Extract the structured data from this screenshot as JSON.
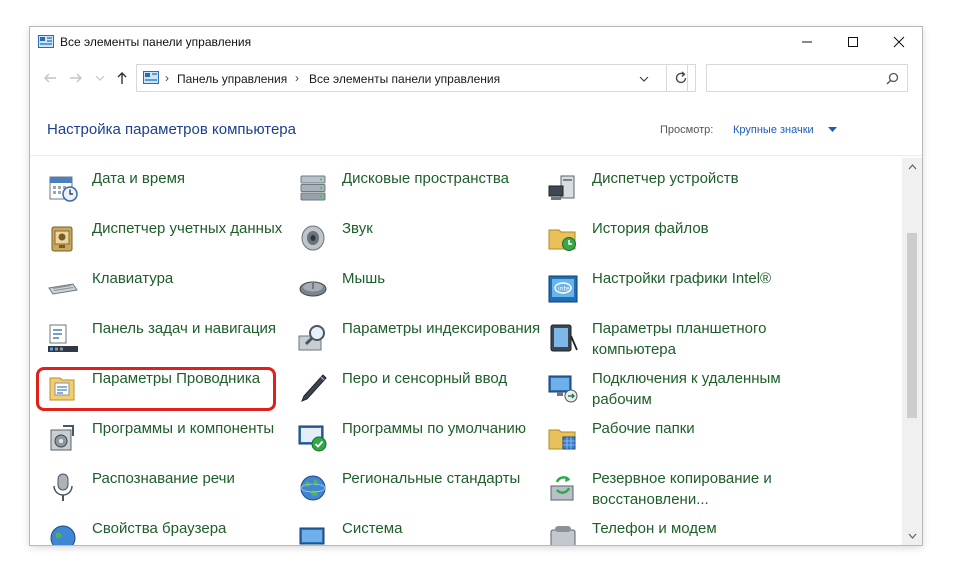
{
  "window": {
    "title": "Все элементы панели управления"
  },
  "address": {
    "crumbs": [
      "Панель управления",
      "Все элементы панели управления"
    ],
    "search_placeholder": ""
  },
  "header": {
    "title": "Настройка параметров компьютера",
    "view_label": "Просмотр:",
    "view_value": "Крупные значки"
  },
  "items": [
    [
      "Дата и время",
      "Дисковые пространства",
      "Диспетчер устройств"
    ],
    [
      "Диспетчер учетных данных",
      "Звук",
      "История файлов"
    ],
    [
      "Клавиатура",
      "Мышь",
      "Настройки графики Intel®"
    ],
    [
      "Панель задач и навигация",
      "Параметры индексирования",
      "Параметры планшетного компьютера"
    ],
    [
      "Параметры Проводника",
      "Перо и сенсорный ввод",
      "Подключения к удаленным рабочим"
    ],
    [
      "Программы и компоненты",
      "Программы по умолчанию",
      "Рабочие папки"
    ],
    [
      "Распознавание речи",
      "Региональные стандарты",
      "Резервное копирование и восстановлени..."
    ],
    [
      "Свойства браузера",
      "Система",
      "Телефон и модем"
    ]
  ],
  "colors": {
    "link": "#1d5e2a",
    "title": "#1c3f8f",
    "highlight": "#e0201b",
    "accent": "#1a5dbf"
  },
  "icons": [
    [
      "calendar-clock-icon",
      "storage-spaces-icon",
      "device-manager-icon"
    ],
    [
      "credential-manager-icon",
      "sound-icon",
      "file-history-icon"
    ],
    [
      "keyboard-icon",
      "mouse-icon",
      "intel-graphics-icon"
    ],
    [
      "taskbar-navigation-icon",
      "indexing-options-icon",
      "tablet-settings-icon"
    ],
    [
      "explorer-options-icon",
      "pen-touch-icon",
      "remote-desktop-icon"
    ],
    [
      "programs-features-icon",
      "default-programs-icon",
      "work-folders-icon"
    ],
    [
      "speech-recognition-icon",
      "region-icon",
      "backup-restore-icon"
    ],
    [
      "internet-options-icon",
      "system-icon",
      "phone-modem-icon"
    ]
  ]
}
